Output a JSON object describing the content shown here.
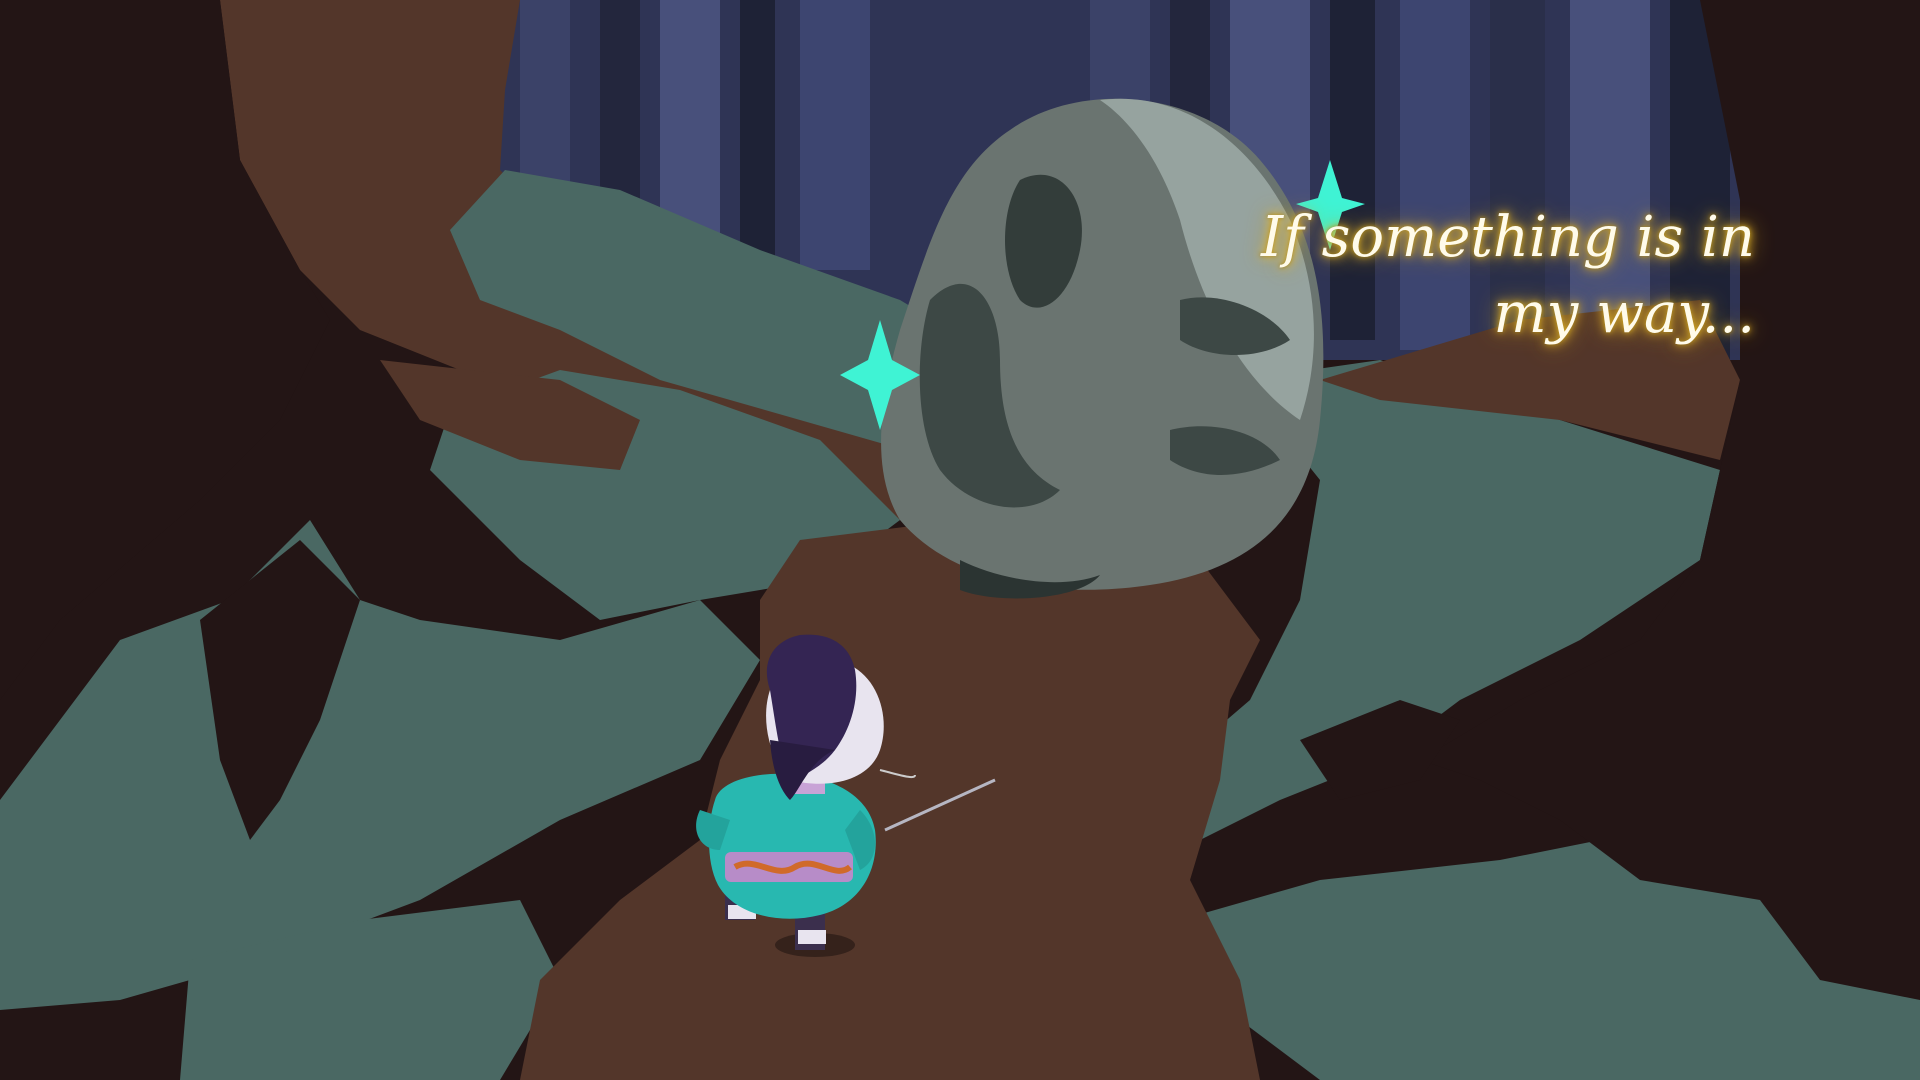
{
  "game": {
    "dialogue": {
      "line1": "If something is in",
      "line2": "my way..."
    }
  },
  "colors": {
    "dark_ground": "#231515",
    "path_brown": "#53362a",
    "grass_teal": "#4a6863",
    "forest_blue": "#343a63",
    "boulder_gray": "#6c7673",
    "sparkle_cyan": "#3ff3d4",
    "kimono_teal": "#28b8b0",
    "text_glow": "#f4c430"
  },
  "icons": {
    "sparkle": "sparkle-icon"
  }
}
